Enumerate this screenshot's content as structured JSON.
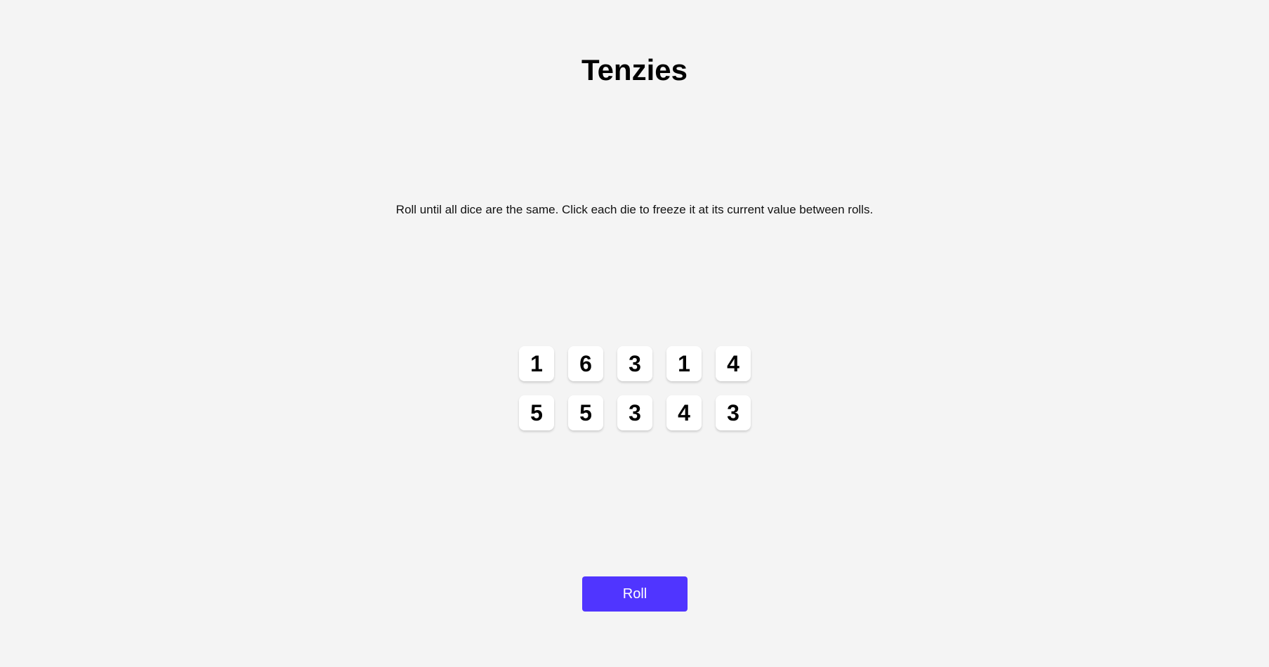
{
  "game": {
    "title": "Tenzies",
    "instructions": "Roll until all dice are the same. Click each die to freeze it at its current value between rolls.",
    "dice": [
      1,
      6,
      3,
      1,
      4,
      5,
      5,
      3,
      4,
      3
    ],
    "roll_label": "Roll"
  },
  "colors": {
    "background": "#f4f4f4",
    "die_face": "#ffffff",
    "roll_button": "#5035ff"
  }
}
